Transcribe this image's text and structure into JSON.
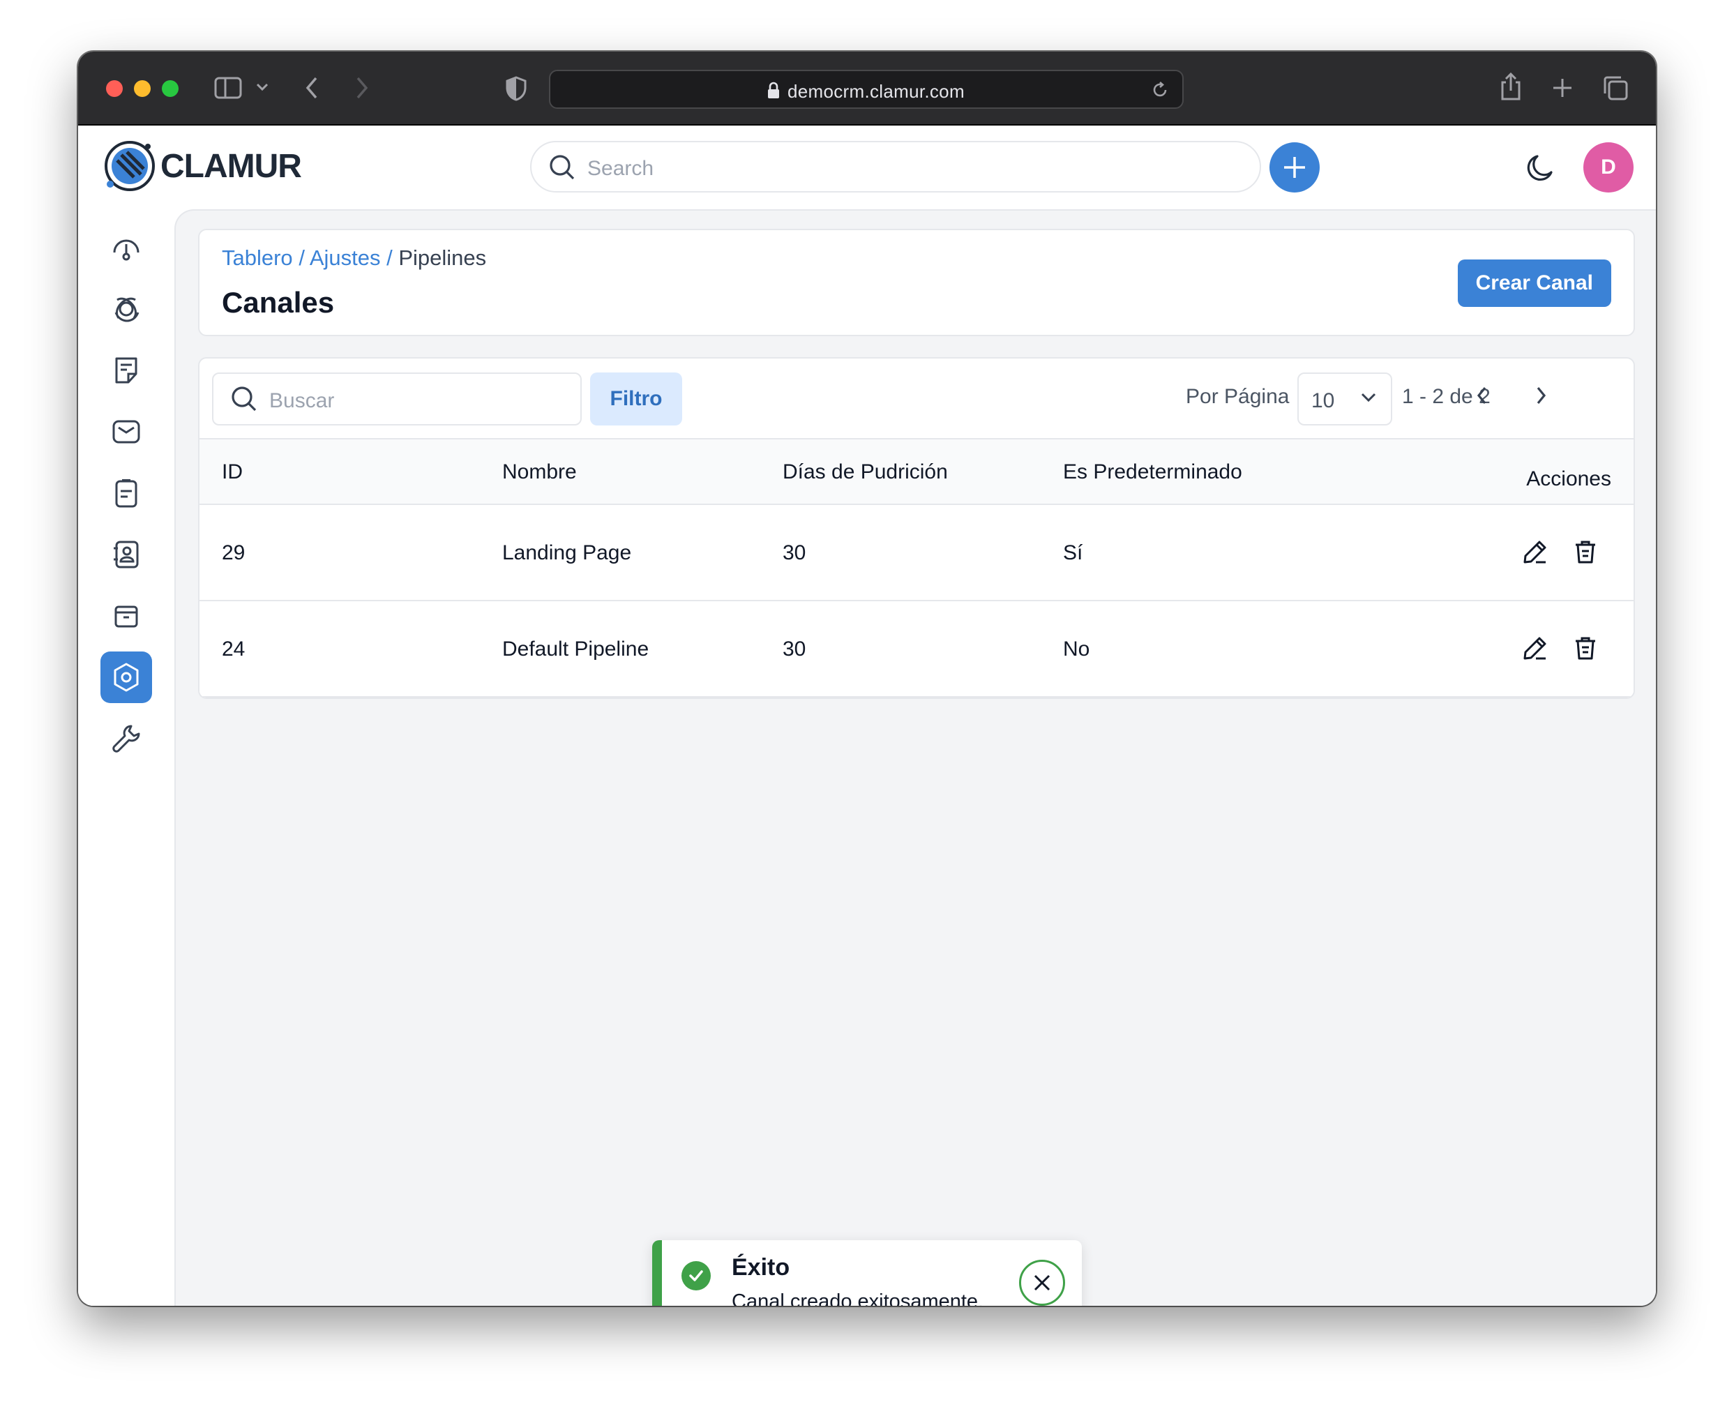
{
  "browser": {
    "url": "democrm.clamur.com"
  },
  "app": {
    "logo_text": "CLAMUR",
    "search_placeholder": "Search",
    "avatar_initial": "D"
  },
  "sidebar": {
    "items": [
      {
        "icon": "dashboard-icon"
      },
      {
        "icon": "leads-icon"
      },
      {
        "icon": "quotes-icon"
      },
      {
        "icon": "mail-icon"
      },
      {
        "icon": "activities-icon"
      },
      {
        "icon": "contacts-icon"
      },
      {
        "icon": "products-icon"
      },
      {
        "icon": "settings-icon",
        "active": true
      },
      {
        "icon": "configuration-wrench-icon"
      }
    ]
  },
  "header": {
    "breadcrumb": [
      "Tablero",
      "Ajustes",
      "Pipelines"
    ],
    "title": "Canales",
    "create_button": "Crear Canal"
  },
  "toolbar": {
    "search_placeholder": "Buscar",
    "filter_label": "Filtro",
    "per_page_label": "Por Página",
    "per_page_value": "10",
    "range_text": "1 - 2 de 2"
  },
  "table": {
    "columns": [
      "ID",
      "Nombre",
      "Días de Pudrición",
      "Es Predeterminado",
      "Acciones"
    ],
    "rows": [
      {
        "id": "29",
        "name": "Landing Page",
        "rotten_days": "30",
        "is_default": "Sí"
      },
      {
        "id": "24",
        "name": "Default Pipeline",
        "rotten_days": "30",
        "is_default": "No"
      }
    ]
  },
  "toast": {
    "title": "Éxito",
    "message": "Canal creado exitosamente."
  },
  "colors": {
    "accent": "#3b82d6",
    "success": "#3fa148",
    "avatar": "#e05ca5"
  }
}
